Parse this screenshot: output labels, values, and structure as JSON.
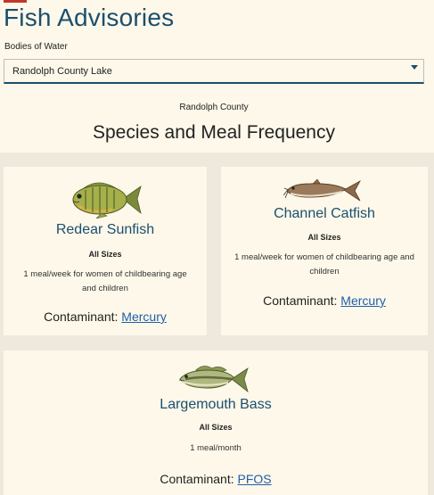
{
  "header": {
    "title": "Fish Advisories",
    "accent_color": "#c0392b"
  },
  "selector": {
    "label": "Bodies of Water",
    "value": "Randolph County Lake"
  },
  "location": {
    "county": "Randolph County"
  },
  "section": {
    "title": "Species and Meal Frequency"
  },
  "cards": [
    {
      "species": "Redear Sunfish",
      "sizes": "All Sizes",
      "frequency": "1 meal/week for women of childbearing age and children",
      "contaminant_label": "Contaminant:",
      "contaminant": "Mercury",
      "icon": "sunfish-icon"
    },
    {
      "species": "Channel Catfish",
      "sizes": "All Sizes",
      "frequency": "1 meal/week for women of childbearing age and children",
      "contaminant_label": "Contaminant:",
      "contaminant": "Mercury",
      "icon": "catfish-icon"
    },
    {
      "species": "Largemouth Bass",
      "sizes": "All Sizes",
      "frequency": "1 meal/month",
      "contaminant_label": "Contaminant:",
      "contaminant": "PFOS",
      "icon": "bass-icon"
    }
  ],
  "colors": {
    "title": "#1b4f6e",
    "link": "#1f5fa8",
    "page_bg": "#fdf8ea",
    "cards_bg": "#efe9dd"
  }
}
